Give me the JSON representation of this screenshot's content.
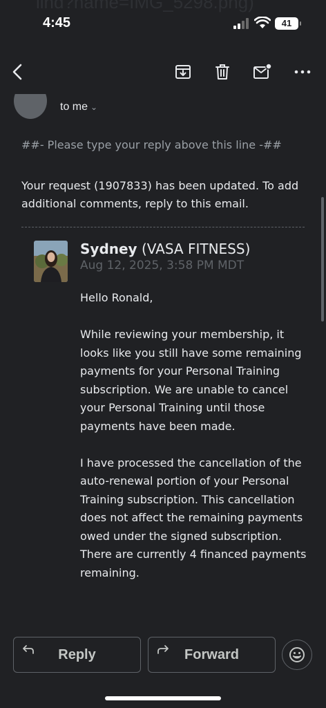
{
  "status_bar": {
    "time": "4:45",
    "battery": "41",
    "ghost_title": "lind?name=IMG_5298.png)"
  },
  "toolbar": {
    "back_icon": "back-arrow-icon",
    "archive_icon": "archive-icon",
    "delete_icon": "trash-icon",
    "mark_unread_icon": "mail-unread-icon",
    "more_icon": "more-dots-icon"
  },
  "email": {
    "recipient": "to me",
    "reply_marker": "##- Please type your reply above this line -##",
    "update_notice": "Your request (1907833) has been updated. To add additional comments, reply to this email.",
    "agent": {
      "name": "Sydney",
      "org": " (VASA FITNESS)",
      "date": "Aug 12, 2025, 3:58 PM MDT"
    },
    "paragraphs": [
      "Hello Ronald,",
      "While reviewing your membership, it looks like you still have some remaining payments for your Personal Training subscription. We are unable to cancel your Personal Training until those payments have been made.",
      "I have processed the cancellation of the auto-renewal portion of your Personal Training subscription. This cancellation does not affect the remaining payments owed under the signed subscription. There are currently 4 financed payments remaining."
    ]
  },
  "actions": {
    "reply_label": "Reply",
    "forward_label": "Forward",
    "emoji_icon": "emoji-reaction-icon"
  },
  "colors": {
    "background": "#202124",
    "text": "#e8eaed",
    "muted": "#9aa0a6",
    "border": "#5f6368"
  }
}
